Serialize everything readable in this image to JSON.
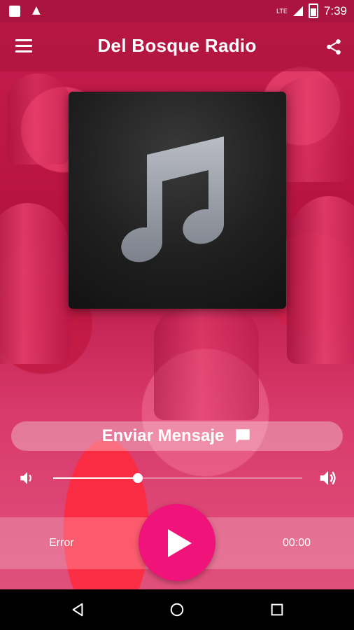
{
  "status_bar": {
    "network": "LTE",
    "time": "7:39"
  },
  "app_bar": {
    "title": "Del Bosque Radio",
    "menu_icon": "hamburger-menu-icon",
    "share_icon": "share-icon"
  },
  "artwork": {
    "icon": "music-note-icon"
  },
  "message": {
    "label": "Enviar Mensaje",
    "icon": "chat-bubble-icon"
  },
  "volume": {
    "level": 0.34,
    "low_icon": "volume-low-icon",
    "high_icon": "volume-high-icon"
  },
  "player": {
    "status": "Error",
    "elapsed": "00:00",
    "play_icon": "play-icon"
  },
  "colors": {
    "accent": "#f0147a",
    "primary": "#c8174f"
  }
}
